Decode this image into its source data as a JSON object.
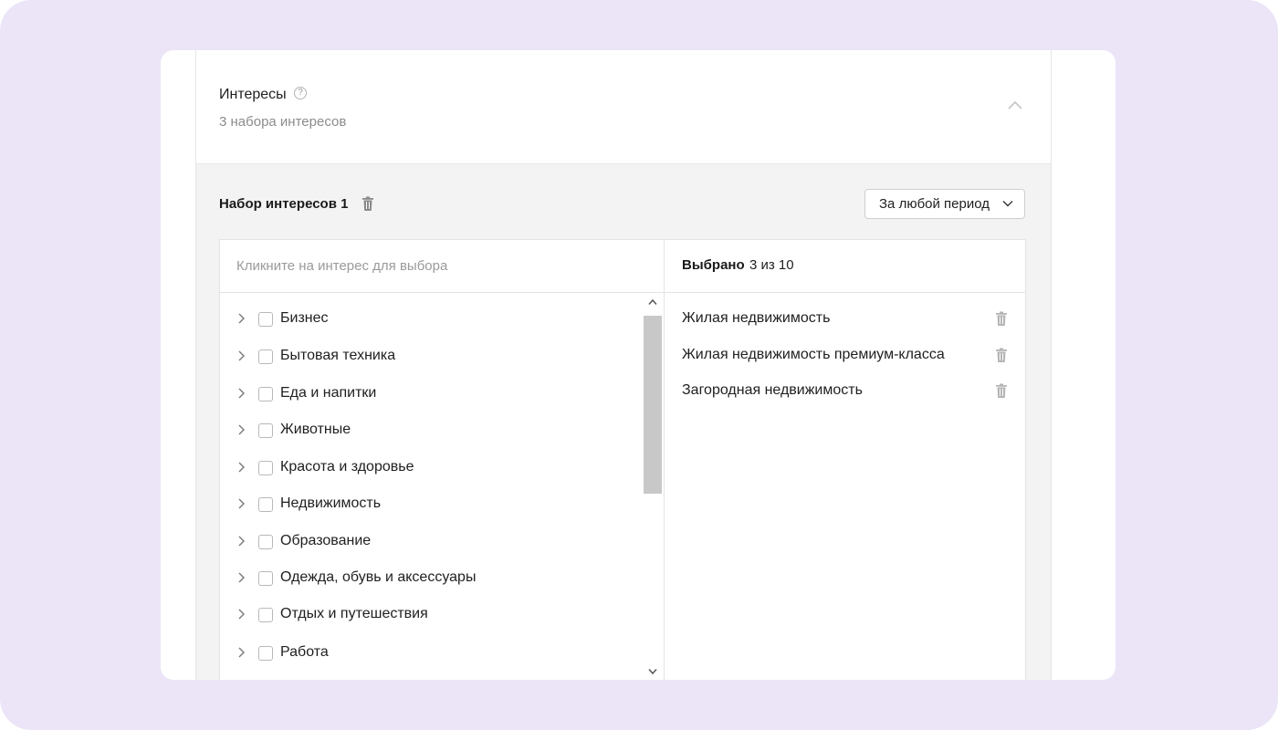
{
  "section": {
    "title": "Интересы",
    "help_icon": "question-circle-icon",
    "subtitle": "3 набора интересов",
    "collapse_icon": "chevron-up-icon"
  },
  "interest_set": {
    "title": "Набор интересов 1",
    "delete_icon": "trash-icon",
    "period_label": "За любой период",
    "period_icon": "chevron-down-icon"
  },
  "picker": {
    "search_placeholder": "Кликните на интерес для выбора",
    "selected_label": "Выбрано",
    "selected_count": "3 из 10",
    "categories": [
      {
        "label": "Бизнес",
        "checked": false
      },
      {
        "label": "Бытовая техника",
        "checked": false
      },
      {
        "label": "Еда и напитки",
        "checked": false
      },
      {
        "label": "Животные",
        "checked": false
      },
      {
        "label": "Красота и здоровье",
        "checked": false
      },
      {
        "label": "Недвижимость",
        "checked": false
      },
      {
        "label": "Образование",
        "checked": false
      },
      {
        "label": "Одежда, обувь и аксессуары",
        "checked": false
      },
      {
        "label": "Отдых и путешествия",
        "checked": false
      },
      {
        "label": "Работа",
        "checked": false
      }
    ],
    "selected_items": [
      {
        "label": "Жилая недвижимость"
      },
      {
        "label": "Жилая недвижимость премиум-класса"
      },
      {
        "label": "Загородная недвижимость"
      }
    ]
  },
  "colors": {
    "frame": "#ebe5f7",
    "panel_body": "#f3f3f3",
    "scroll_thumb": "#c8c8c8"
  }
}
